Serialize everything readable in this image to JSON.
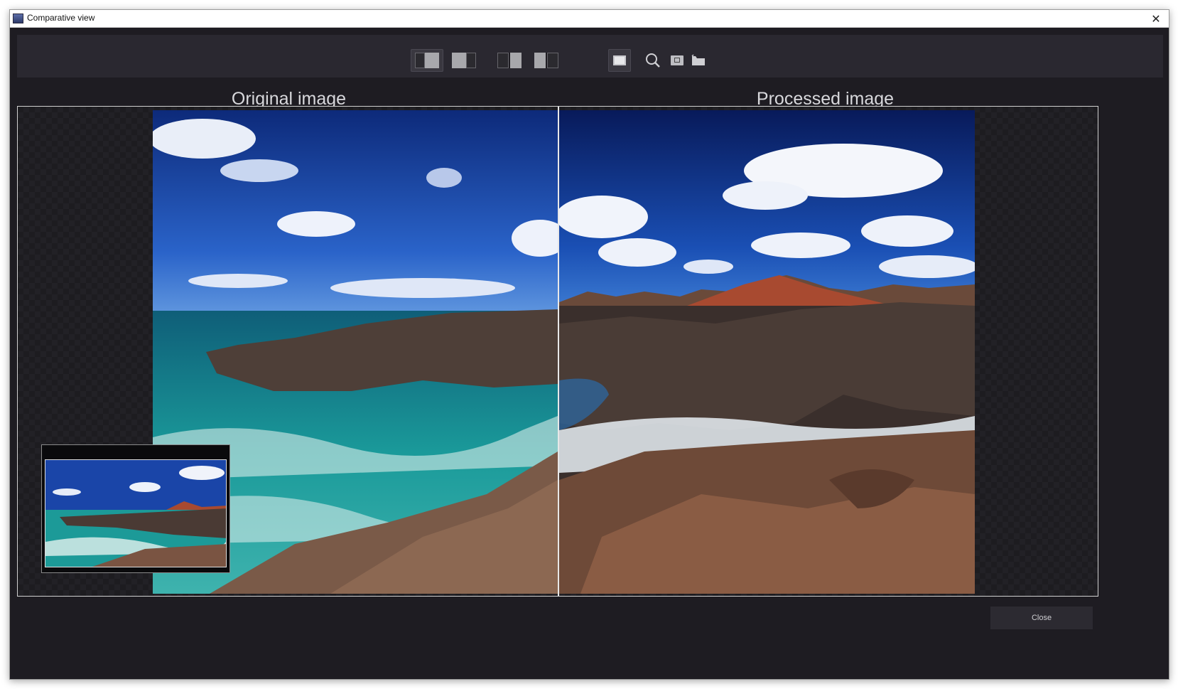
{
  "window": {
    "title": "Comparative view",
    "close_glyph": "✕"
  },
  "toolbar": {
    "buttons": [
      {
        "icon": "split-view-left-icon",
        "active": true
      },
      {
        "icon": "split-view-right-icon",
        "active": false
      },
      {
        "icon": "side-by-side-icon",
        "active": false
      },
      {
        "icon": "side-by-side-alt-icon",
        "active": false
      },
      {
        "icon": "fit-window-icon",
        "active": true
      },
      {
        "icon": "magnifier-icon",
        "active": false
      },
      {
        "icon": "navigator-icon",
        "active": false
      },
      {
        "icon": "folder-icon",
        "active": false
      }
    ]
  },
  "panes": {
    "left_label": "Original image",
    "right_label": "Processed image"
  },
  "footer": {
    "close_label": "Close"
  },
  "colors": {
    "accent_bg": "#1e1c22",
    "toolbar_bg": "#2a2830",
    "text": "#d8d8dc"
  }
}
